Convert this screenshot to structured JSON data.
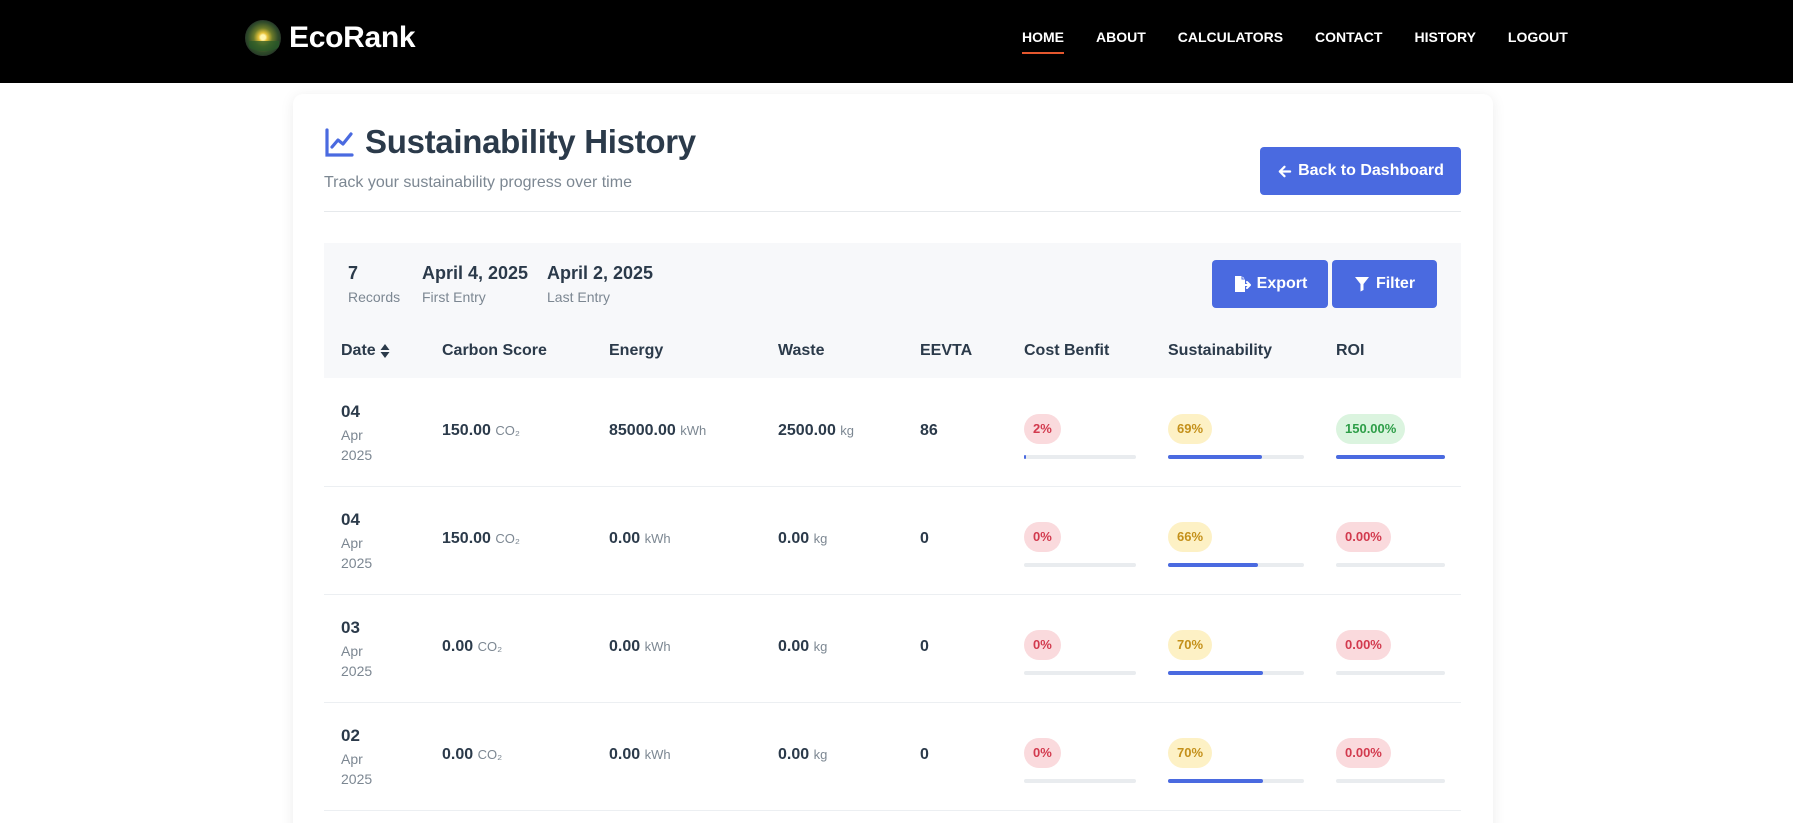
{
  "brand": {
    "name": "EcoRank"
  },
  "nav": [
    {
      "label": "HOME",
      "active": true
    },
    {
      "label": "ABOUT"
    },
    {
      "label": "CALCULATORS"
    },
    {
      "label": "CONTACT"
    },
    {
      "label": "HISTORY"
    },
    {
      "label": "LOGOUT"
    }
  ],
  "header": {
    "title": "Sustainability History",
    "subtitle": "Track your sustainability progress over time",
    "back_label": "Back to Dashboard"
  },
  "summary": {
    "records_value": "7",
    "records_label": "Records",
    "first_value": "April 4, 2025",
    "first_label": "First Entry",
    "last_value": "April 2, 2025",
    "last_label": "Last Entry",
    "export_label": "Export",
    "filter_label": "Filter"
  },
  "table": {
    "headers": [
      "Date",
      "Carbon Score",
      "Energy",
      "Waste",
      "EEVTA",
      "Cost Benfit",
      "Sustainability",
      "ROI"
    ],
    "units": {
      "carbon": "CO₂",
      "energy": "kWh",
      "waste": "kg"
    },
    "rows": [
      {
        "day": "04",
        "month": "Apr",
        "year": "2025",
        "carbon": "150.00",
        "energy": "85000.00",
        "waste": "2500.00",
        "eevta": "86",
        "cost": "2%",
        "cost_level": 0.02,
        "sustain": "69%",
        "sustain_level": 0.69,
        "roi": "150.00%",
        "roi_level": 1.0,
        "roi_status": "positive"
      },
      {
        "day": "04",
        "month": "Apr",
        "year": "2025",
        "carbon": "150.00",
        "energy": "0.00",
        "waste": "0.00",
        "eevta": "0",
        "cost": "0%",
        "cost_level": 0,
        "sustain": "66%",
        "sustain_level": 0.66,
        "roi": "0.00%",
        "roi_level": 0,
        "roi_status": "negative"
      },
      {
        "day": "03",
        "month": "Apr",
        "year": "2025",
        "carbon": "0.00",
        "energy": "0.00",
        "waste": "0.00",
        "eevta": "0",
        "cost": "0%",
        "cost_level": 0,
        "sustain": "70%",
        "sustain_level": 0.7,
        "roi": "0.00%",
        "roi_level": 0,
        "roi_status": "negative"
      },
      {
        "day": "02",
        "month": "Apr",
        "year": "2025",
        "carbon": "0.00",
        "energy": "0.00",
        "waste": "0.00",
        "eevta": "0",
        "cost": "0%",
        "cost_level": 0,
        "sustain": "70%",
        "sustain_level": 0.7,
        "roi": "0.00%",
        "roi_level": 0,
        "roi_status": "negative"
      }
    ]
  },
  "colors": {
    "accent": "#4a6ae0",
    "navbar": "#000000",
    "active_underline": "#e4572e"
  }
}
